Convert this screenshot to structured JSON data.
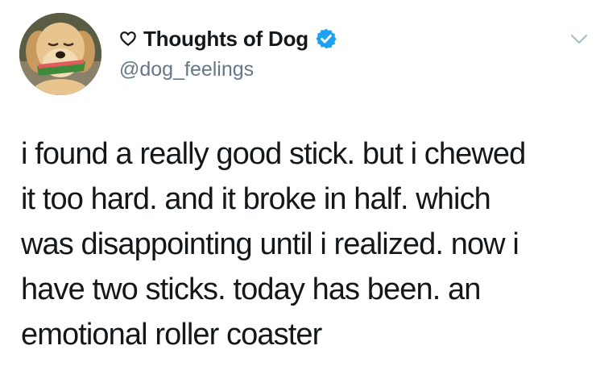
{
  "account": {
    "display_name": "Thoughts of Dog",
    "handle": "@dog_feelings",
    "verified": true,
    "name_prefix_icon": "heart-outline-icon",
    "avatar_description_icon": "dog-avatar"
  },
  "tweet": {
    "text": "i found a really good stick. but i chewed\nit too hard. and it broke in half. which\nwas disappointing until i realized. now i\nhave two sticks. today has been. an\nemotional roller coaster"
  },
  "colors": {
    "verified_badge": "#1da1f2",
    "handle": "#657786",
    "text": "#14171a",
    "caret": "#aab8c2"
  }
}
